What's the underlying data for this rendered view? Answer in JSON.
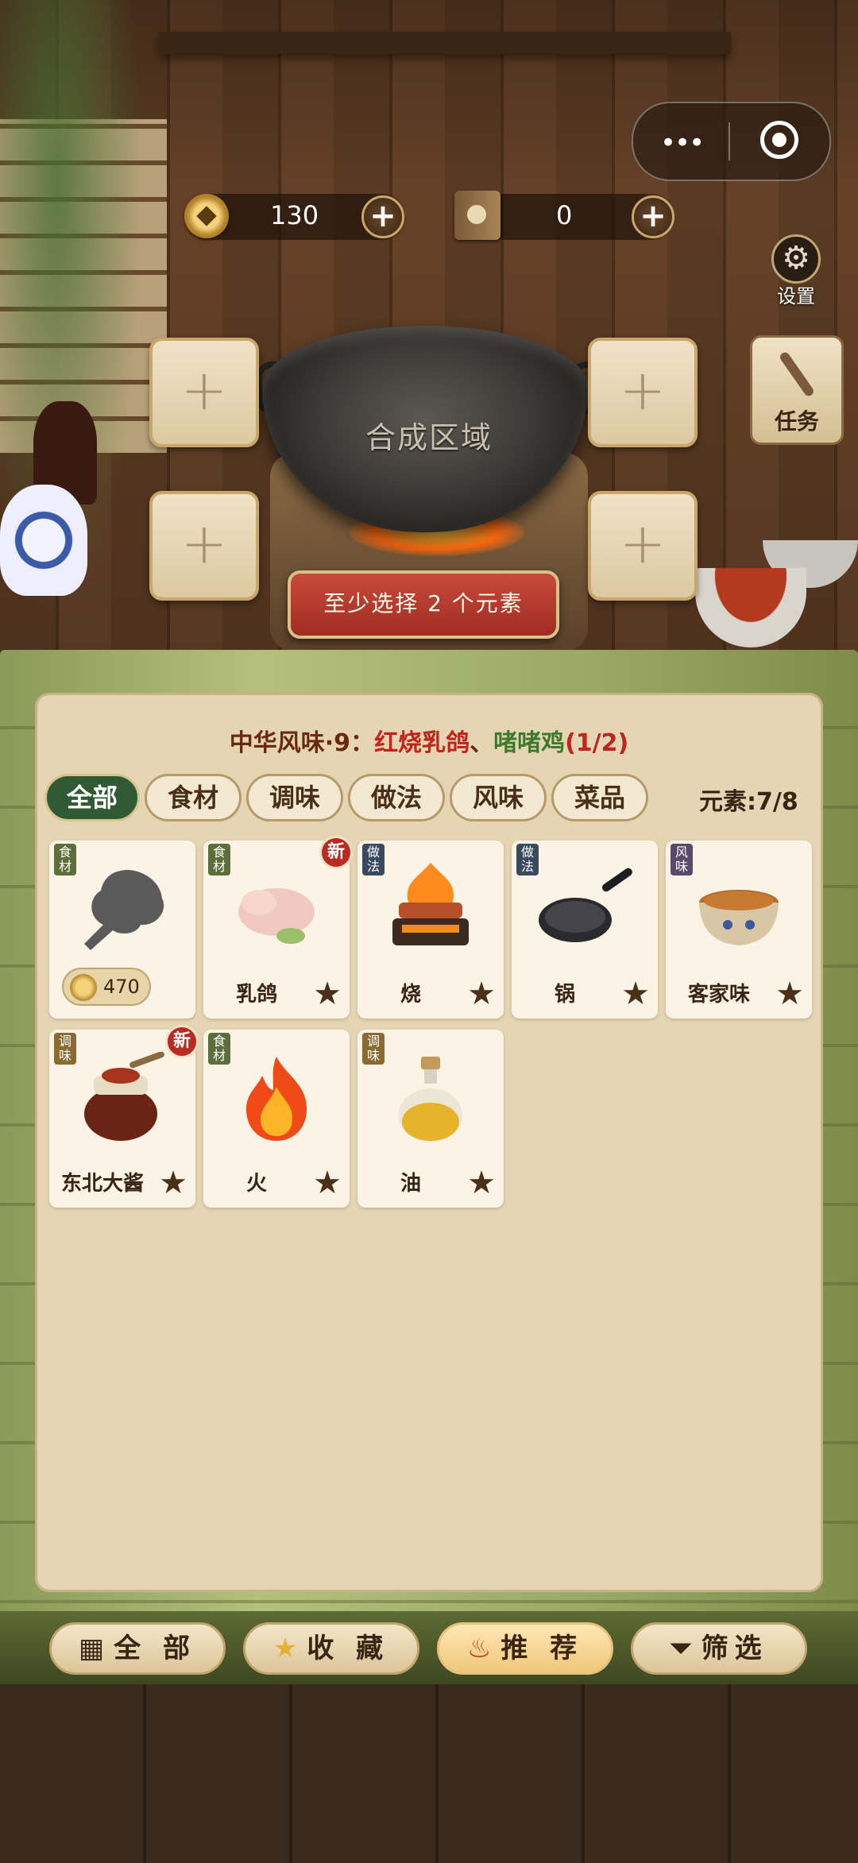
{
  "top_bar": {
    "menu_dots": "•••"
  },
  "currency": {
    "coins": "130",
    "books": "0",
    "plus": "+"
  },
  "side": {
    "settings_label": "设置",
    "task_label": "任务"
  },
  "synth": {
    "wok_label": "合成区域",
    "slot_plus": "+",
    "hint": "至少选择 2 个元素"
  },
  "recipe": {
    "prefix": "中华风味·9：",
    "dish1": "红烧乳鸽",
    "sep": "、",
    "dish2": "啫啫鸡",
    "progress": "(1/2)"
  },
  "tabs": [
    "全部",
    "食材",
    "调味",
    "做法",
    "风味",
    "菜品"
  ],
  "element_count": "元素:7/8",
  "cards": [
    {
      "category": "食材",
      "name": "",
      "price": "470",
      "locked": true
    },
    {
      "category": "食材",
      "name": "乳鸽",
      "is_new": true,
      "new_label": "新"
    },
    {
      "category": "做法",
      "name": "烧"
    },
    {
      "category": "做法",
      "name": "锅"
    },
    {
      "category": "风味",
      "name": "客家味"
    },
    {
      "category": "调味",
      "name": "东北大酱",
      "is_new": true,
      "new_label": "新"
    },
    {
      "category": "食材",
      "name": "火"
    },
    {
      "category": "调味",
      "name": "油"
    }
  ],
  "star_glyph": "★",
  "bottom_nav": [
    {
      "label": "全 部",
      "icon": "grid-icon"
    },
    {
      "label": "收 藏",
      "icon": "star-icon"
    },
    {
      "label": "推 荐",
      "icon": "fire-icon",
      "active": true
    },
    {
      "label": "筛选",
      "icon": "filter-icon"
    }
  ]
}
